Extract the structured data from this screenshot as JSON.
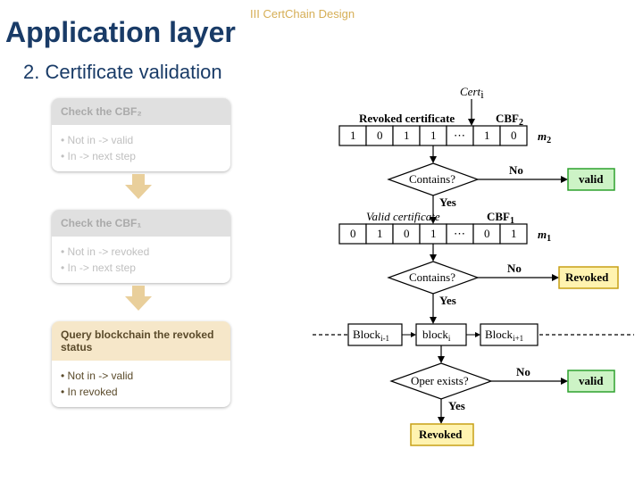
{
  "page_label": "III   CertChain Design",
  "title": "Application layer",
  "subtitle": "2. Certificate validation",
  "cards": [
    {
      "title": "Check the CBF₂",
      "line1": "• Not in -> valid",
      "line2": "• In -> next step"
    },
    {
      "title": "Check the CBF₁",
      "line1": "• Not in -> revoked",
      "line2": "• In -> next step"
    },
    {
      "title": "Query blockchain the revoked status",
      "line1": "• Not in -> valid",
      "line2": "• In revoked"
    }
  ],
  "diagram": {
    "cert_label": "Cert",
    "cert_sub": "i",
    "row1_label": "Revoked certificate",
    "cbf2_label": "CBF",
    "cbf2_sub": "2",
    "row1_bits": [
      "1",
      "0",
      "1",
      "1",
      "⋯",
      "1",
      "0"
    ],
    "m2": "m",
    "m2sub": "2",
    "contains": "Contains?",
    "yes": "Yes",
    "no": "No",
    "valid": "valid",
    "row2_label": "Valid certificate",
    "cbf1_label": "CBF",
    "cbf1_sub": "1",
    "row2_bits": [
      "0",
      "1",
      "0",
      "1",
      "⋯",
      "0",
      "1"
    ],
    "m1": "m",
    "m1sub": "1",
    "revoked": "Revoked",
    "blocks": [
      "Block",
      "block",
      "Block"
    ],
    "block_subs": [
      "i-1",
      "i",
      "i+1"
    ],
    "oper": "Oper exists?"
  }
}
